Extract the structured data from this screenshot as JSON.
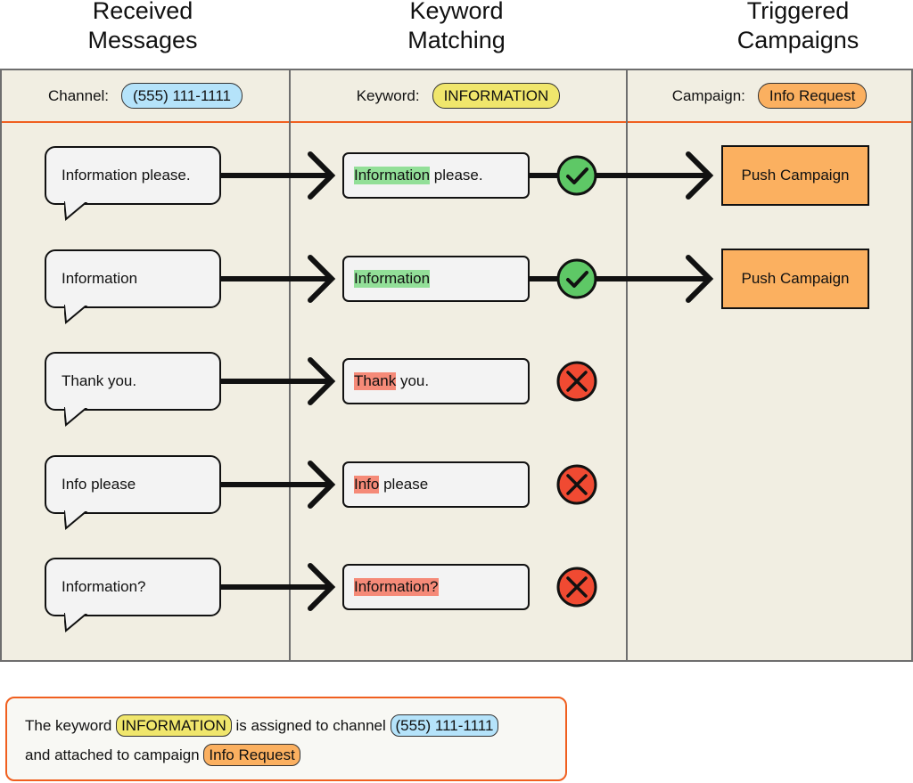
{
  "columns": [
    {
      "title_line1": "Received",
      "title_line2": "Messages",
      "header_label": "Channel:",
      "header_value": "(555) 111-1111"
    },
    {
      "title_line1": "Keyword",
      "title_line2": "Matching",
      "header_label": "Keyword:",
      "header_value": "INFORMATION"
    },
    {
      "title_line1": "Triggered",
      "title_line2": "Campaigns",
      "header_label": "Campaign:",
      "header_value": "Info Request"
    }
  ],
  "rows": [
    {
      "message": "Information please.",
      "highlight": "Information",
      "rest": " please.",
      "matched": true,
      "campaign": "Push Campaign"
    },
    {
      "message": "Information",
      "highlight": "Information",
      "rest": "",
      "matched": true,
      "campaign": "Push Campaign"
    },
    {
      "message": "Thank you.",
      "highlight": "Thank",
      "rest": " you.",
      "matched": false,
      "campaign": ""
    },
    {
      "message": "Info please",
      "highlight": "Info",
      "rest": " please",
      "matched": false,
      "campaign": ""
    },
    {
      "message": "Information?",
      "highlight": "Information?",
      "rest": "",
      "matched": false,
      "campaign": ""
    }
  ],
  "note": {
    "part1": "The keyword",
    "keyword": "INFORMATION",
    "part2": "is assigned to channel",
    "channel": "(555) 111-1111",
    "part3": "and attached to campaign",
    "campaign": "Info Request"
  },
  "colors": {
    "panel_bg": "#f1eee2",
    "header_divider": "#f05f1f",
    "channel_pill": "#b5e3fa",
    "keyword_pill": "#f0e66c",
    "campaign_pill": "#fbb060",
    "match_highlight": "#92df98",
    "nomatch_highlight": "#f58a78",
    "check_fill": "#5ec866",
    "cross_fill": "#f04a32"
  }
}
